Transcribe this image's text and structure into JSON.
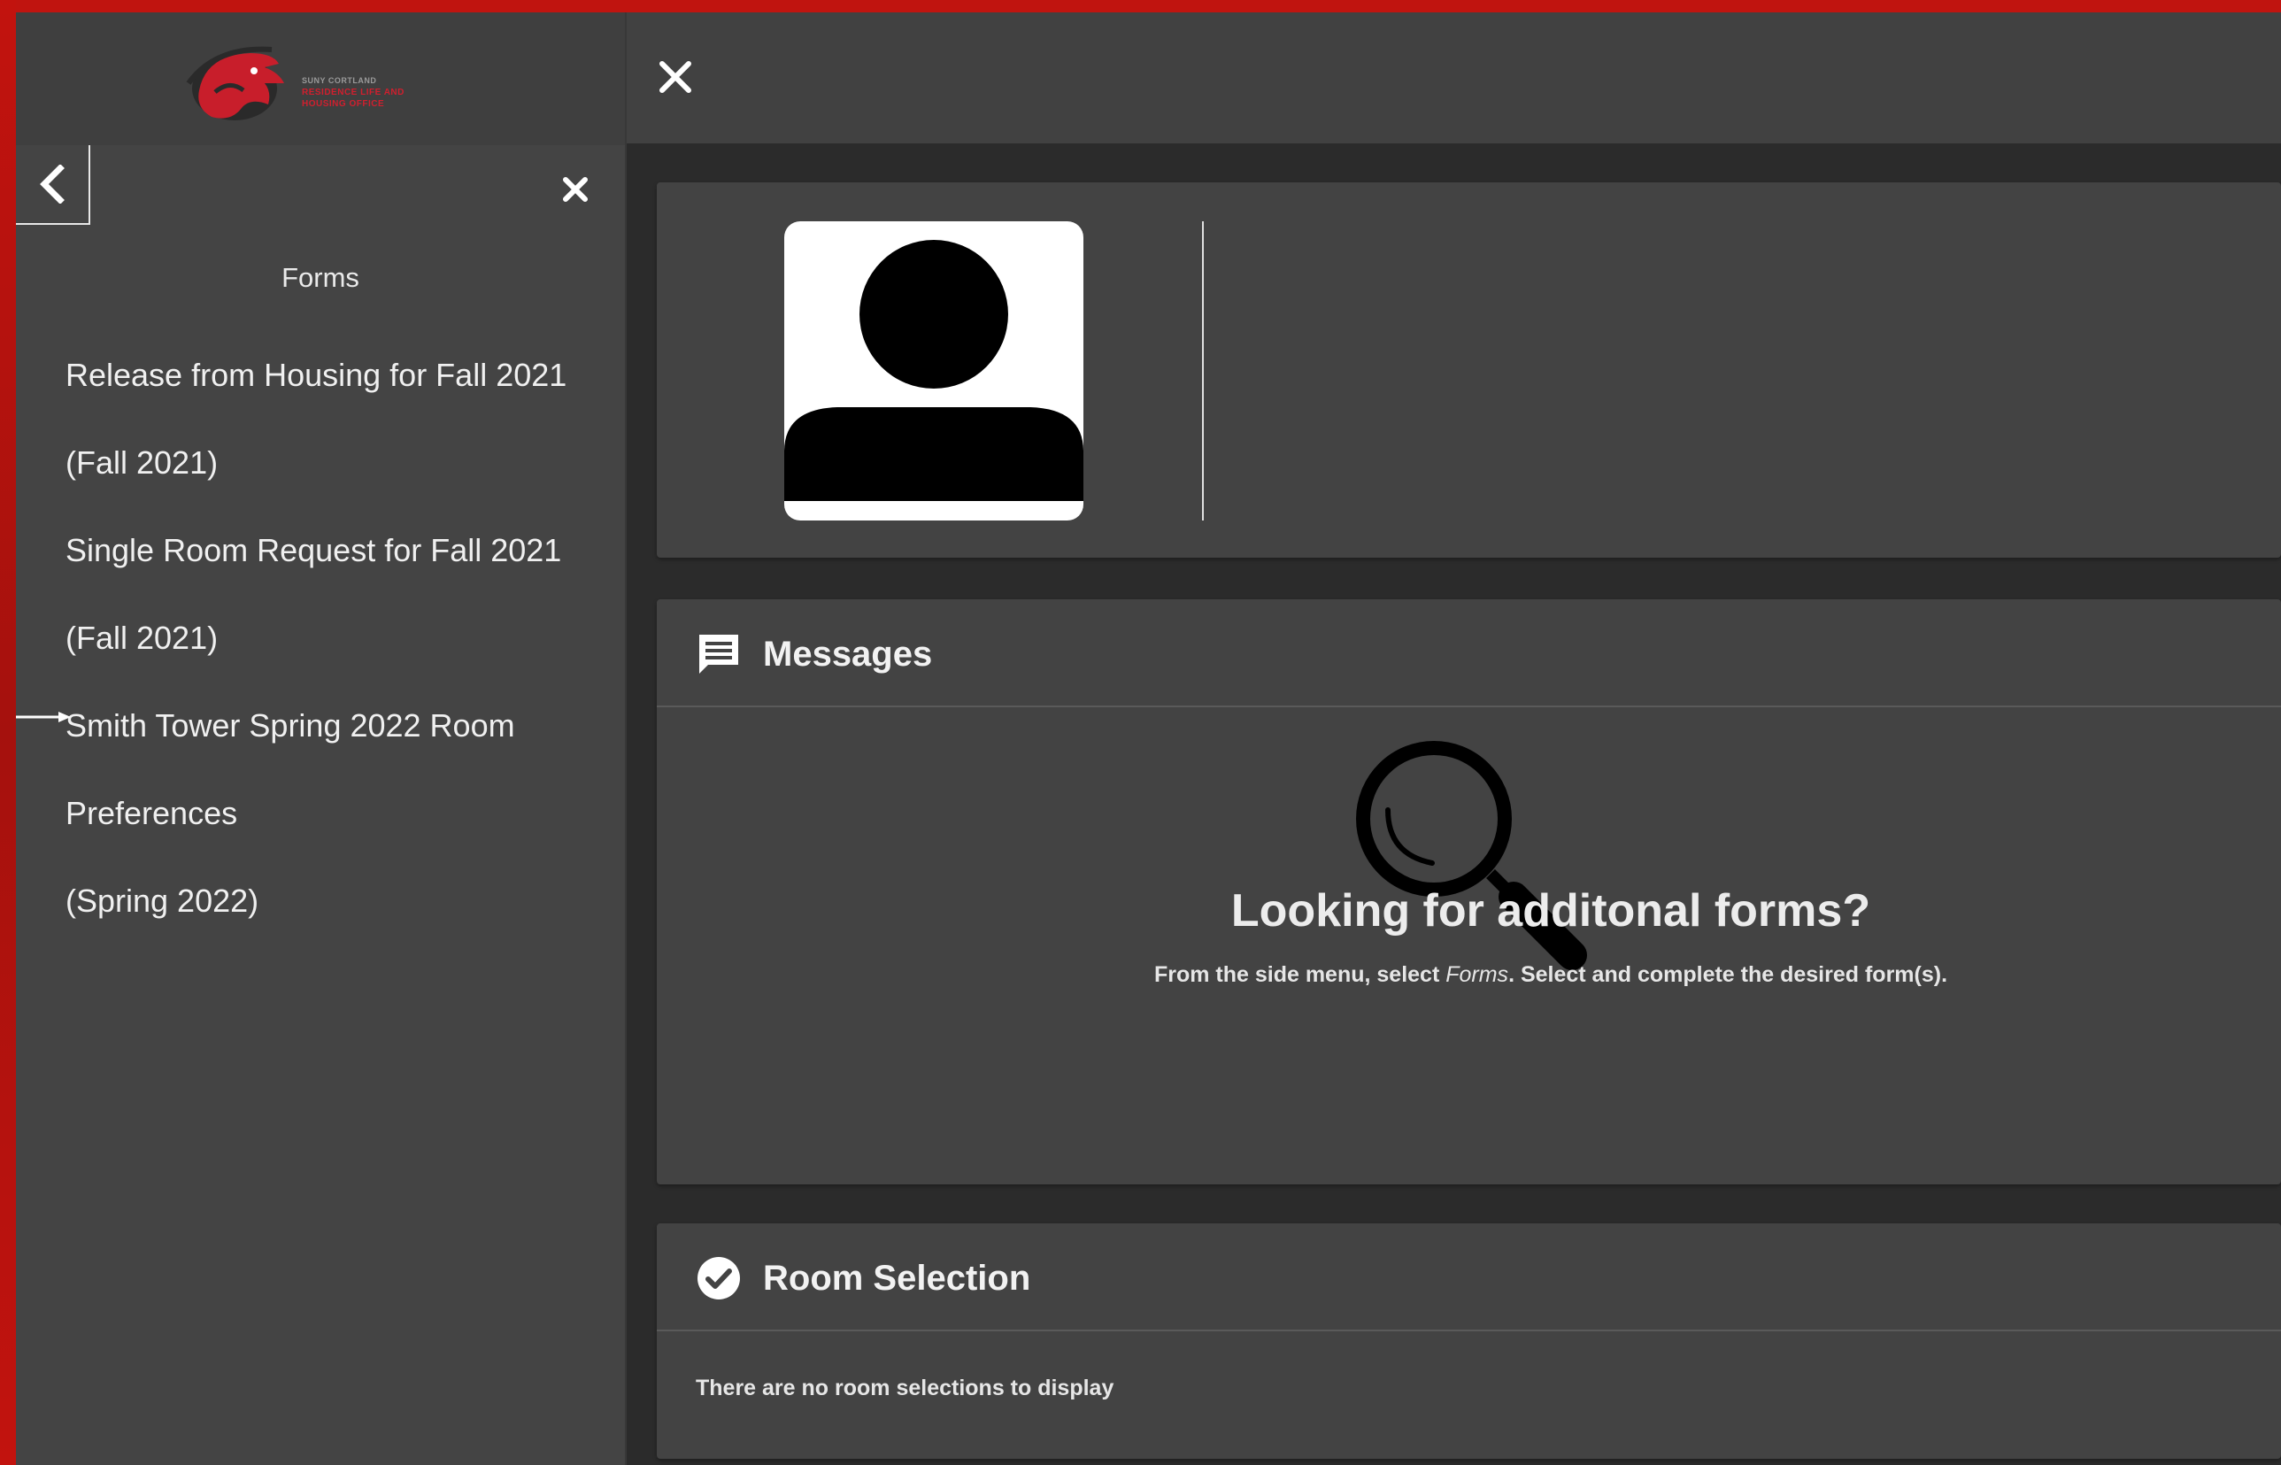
{
  "logo": {
    "line1": "SUNY CORTLAND",
    "line2": "RESIDENCE LIFE AND",
    "line3": "HOUSING OFFICE"
  },
  "sidebar": {
    "heading": "Forms",
    "forms": [
      "Release from Housing for Fall 2021",
      "(Fall 2021)",
      "Single Room Request for Fall 2021",
      "(Fall 2021)",
      "Smith Tower Spring 2022 Room",
      "Preferences",
      "(Spring 2022)"
    ]
  },
  "messages": {
    "title": "Messages",
    "empty_heading": "Looking for additonal forms?",
    "empty_sub_before": "From the side menu, select ",
    "empty_sub_em": "Forms",
    "empty_sub_after": ". Select and complete the desired form(s)."
  },
  "room_selection": {
    "title": "Room Selection",
    "empty_text": "There are no room selections to display"
  },
  "icons": {
    "back": "chevron-left-icon",
    "close_sidebar": "close-icon",
    "close_main": "close-icon",
    "messages": "chat-bubble-icon",
    "room": "check-circle-icon",
    "empty": "magnifier-icon",
    "avatar": "user-silhouette-icon"
  },
  "colors": {
    "brand_red": "#c0140f",
    "logo_red": "#d01f2e",
    "panel": "#434343",
    "sidebar": "#444444"
  }
}
